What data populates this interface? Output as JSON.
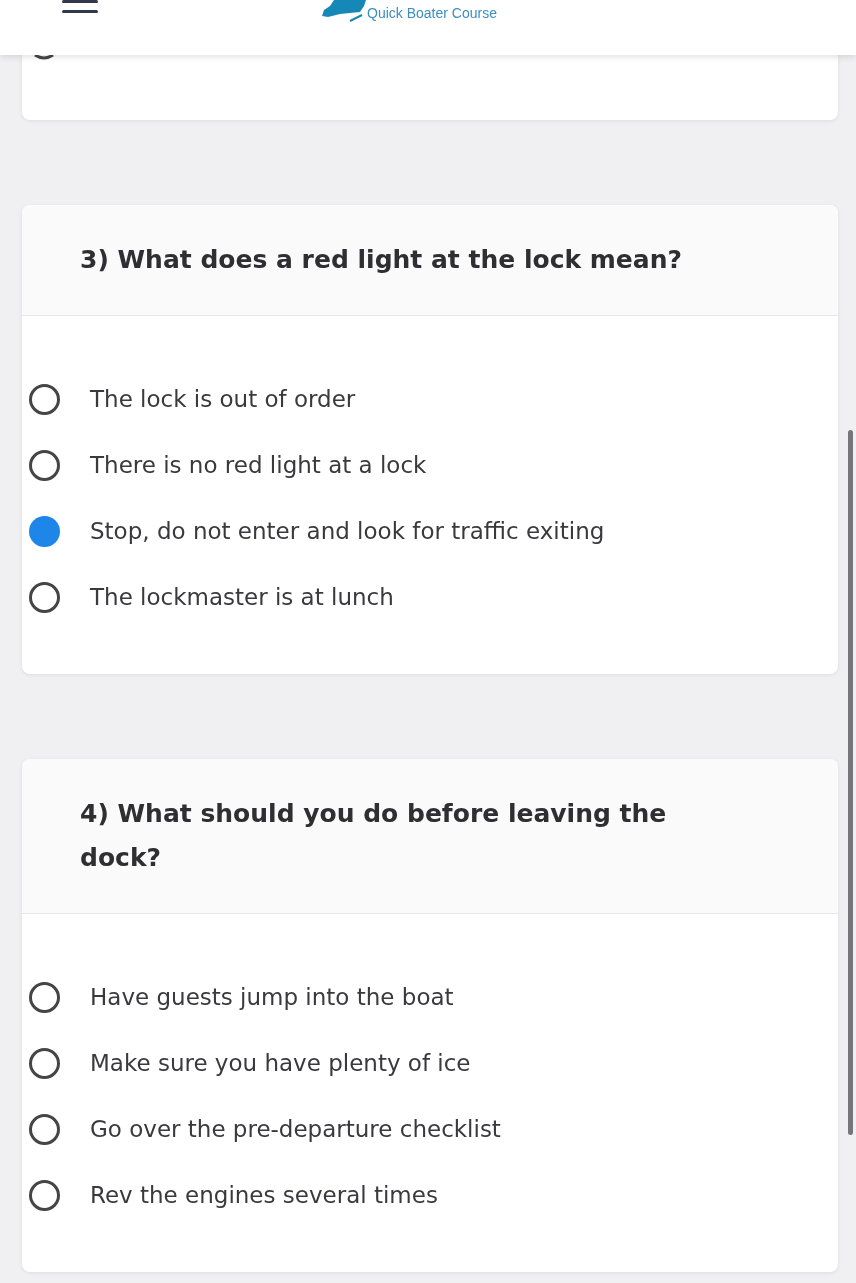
{
  "header": {
    "logo_subtitle": "Quick Boater Course"
  },
  "questions": [
    {
      "text": "3) What does a red light at the lock mean?",
      "options": [
        {
          "label": "The lock is out of order",
          "selected": false
        },
        {
          "label": "There is no red light at a lock",
          "selected": false
        },
        {
          "label": "Stop, do not enter and look for traffic exiting",
          "selected": true
        },
        {
          "label": "The lockmaster is at lunch",
          "selected": false
        }
      ]
    },
    {
      "text": "4) What should you do before leaving the dock?",
      "options": [
        {
          "label": "Have guests jump into the boat",
          "selected": false
        },
        {
          "label": "Make sure you have plenty of ice",
          "selected": false
        },
        {
          "label": "Go over the pre-departure checklist",
          "selected": false
        },
        {
          "label": "Rev the engines several times",
          "selected": false
        }
      ]
    }
  ]
}
